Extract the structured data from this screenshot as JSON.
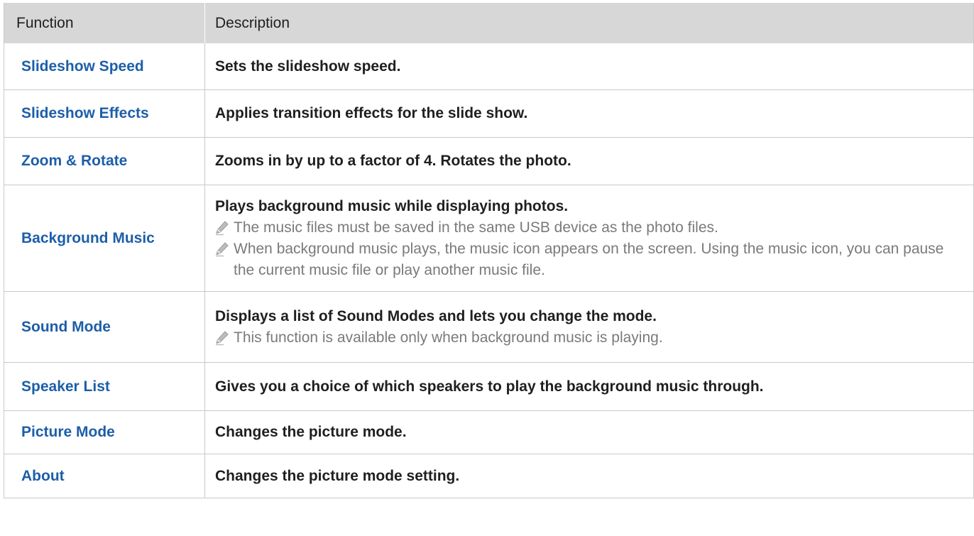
{
  "header": {
    "function_label": "Function",
    "description_label": "Description"
  },
  "rows": [
    {
      "function": "Slideshow Speed",
      "description": "Sets the slideshow speed."
    },
    {
      "function": "Slideshow Effects",
      "description": "Applies transition effects for the slide show."
    },
    {
      "function": "Zoom & Rotate",
      "description": "Zooms in by up to a factor of 4. Rotates the photo."
    },
    {
      "function": "Background Music",
      "description": "Plays background music while displaying photos.",
      "notes": [
        "The music files must be saved in the same USB device as the photo files.",
        "When background music plays, the music icon appears on the screen. Using the music icon, you can pause the current music file or play another music file."
      ]
    },
    {
      "function": "Sound Mode",
      "description": "Displays a list of Sound Modes and lets you change the mode.",
      "notes": [
        "This function is available only when background music is playing."
      ]
    },
    {
      "function": "Speaker List",
      "description": "Gives you a choice of which speakers to play the background music through."
    },
    {
      "function": "Picture Mode",
      "description": "Changes the picture mode."
    },
    {
      "function": "About",
      "description": "Changes the picture mode setting."
    }
  ],
  "colors": {
    "function_text": "#1d5ea8",
    "header_bg": "#d7d7d7",
    "note_text": "#7a7a7a"
  },
  "icons": {
    "note": "pencil-icon"
  }
}
